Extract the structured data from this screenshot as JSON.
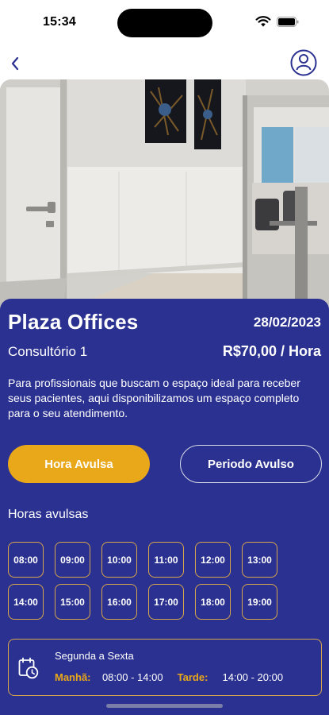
{
  "status": {
    "time": "15:34"
  },
  "venue": {
    "name": "Plaza Offices",
    "date": "28/02/2023",
    "room": "Consultório 1",
    "price": "R$70,00 / Hora",
    "description": "Para profissionais que buscam o espaço ideal para receber seus pacientes, aqui disponibilizamos um espaço completo para o seu atendimento."
  },
  "buttons": {
    "hour_label": "Hora Avulsa",
    "period_label": "Periodo Avulso"
  },
  "hours": {
    "label": "Horas avulsas",
    "slots": [
      "08:00",
      "09:00",
      "10:00",
      "11:00",
      "12:00",
      "13:00",
      "14:00",
      "15:00",
      "16:00",
      "17:00",
      "18:00",
      "19:00"
    ]
  },
  "schedule": {
    "days": "Segunda a Sexta",
    "morning_label": "Manhã:",
    "morning_value": "08:00 - 14:00",
    "afternoon_label": "Tarde:",
    "afternoon_value": "14:00 - 20:00"
  },
  "colors": {
    "card": "#2b3190",
    "accent": "#e9a81a",
    "chip_border": "#d8a64a"
  }
}
